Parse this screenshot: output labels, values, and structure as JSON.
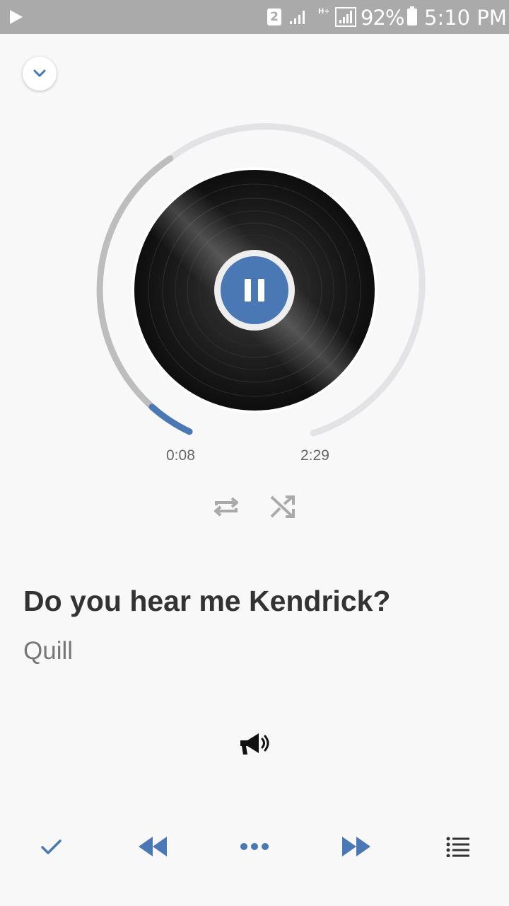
{
  "status_bar": {
    "sim_number": "2",
    "network_type": "H+",
    "battery_text": "92%",
    "clock": "5:10 PM"
  },
  "player": {
    "elapsed": "0:08",
    "total": "2:29",
    "progress_fraction": 0.054,
    "state": "playing"
  },
  "track": {
    "title": "Do you hear me Kendrick?",
    "artist": "Quill"
  },
  "icons": {
    "collapse": "chevron-down-icon",
    "pause": "pause-icon",
    "repeat": "repeat-icon",
    "shuffle": "shuffle-icon",
    "announce": "megaphone-icon",
    "check": "check-icon",
    "rewind": "rewind-icon",
    "more": "more-dots-icon",
    "fast_forward": "fast-forward-icon",
    "playlist": "playlist-icon"
  },
  "colors": {
    "accent": "#4a78b5",
    "status_bar": "#aaaaaa",
    "background": "#f8f8f8"
  }
}
